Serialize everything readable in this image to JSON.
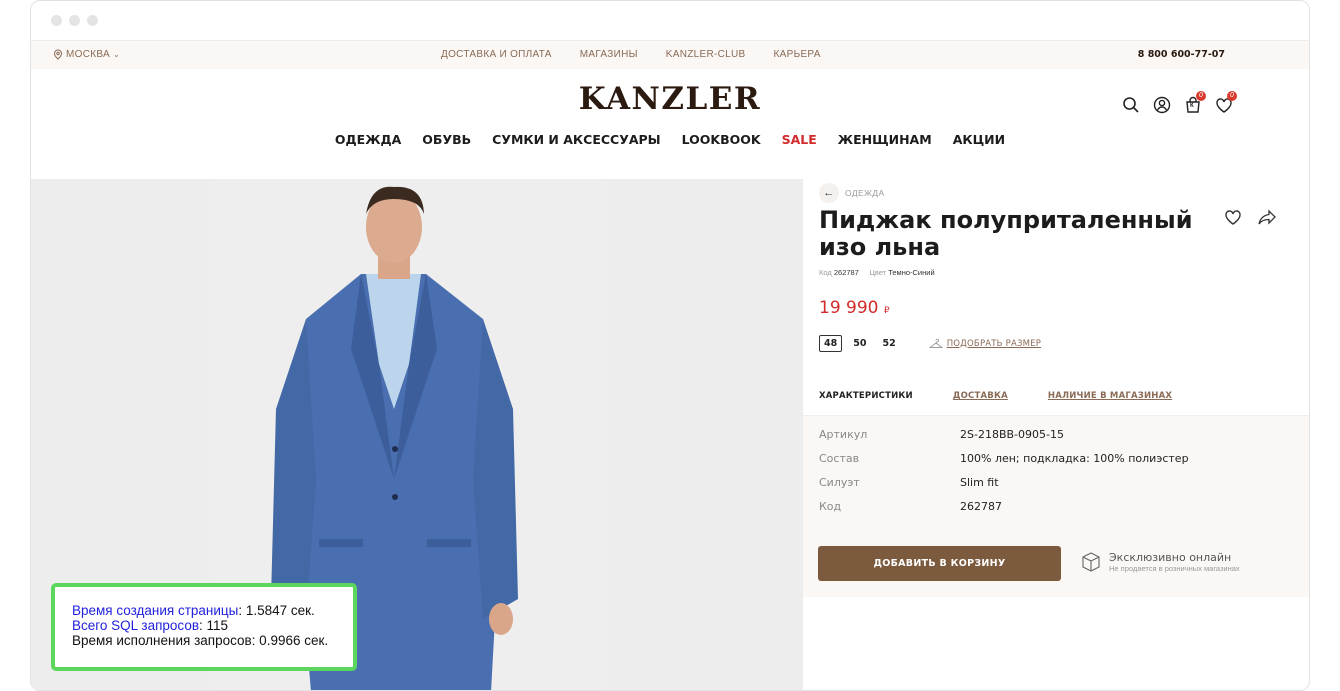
{
  "topbar": {
    "city": "МОСКВА",
    "nav": [
      "ДОСТАВКА И ОПЛАТА",
      "МАГАЗИНЫ",
      "KANZLER-CLUB",
      "КАРЬЕРА"
    ],
    "phone": "8 800 600-77-07"
  },
  "header": {
    "logo": "KANZLER",
    "cart_count": "0",
    "fav_count": "0",
    "cart_letter": "К"
  },
  "mainnav": [
    "ОДЕЖДА",
    "ОБУВЬ",
    "СУМКИ И АКСЕССУАРЫ",
    "LOOKBOOK",
    "SALE",
    "ЖЕНЩИНАМ",
    "АКЦИИ"
  ],
  "colors": {
    "brand": "#2b1a10",
    "accent": "#7c5a3e",
    "sale": "#d32b2b",
    "debug_border": "#5cd65c"
  },
  "debug": {
    "time_label": "Время создания страницы",
    "time_value": ": 1.5847 сек.",
    "sql_label": "Всего SQL запросов",
    "sql_value": ": 115",
    "exec_text": "Время исполнения запросов: 0.9966 сек."
  },
  "product": {
    "breadcrumb": "ОДЕЖДА",
    "title": "Пиджак полуприталенный изо льна",
    "code_label": "Код",
    "code": "262787",
    "color_label": "Цвет",
    "color": "Темно-Синий",
    "price": "19 990",
    "currency": "₽",
    "sizes": [
      "48",
      "50",
      "52"
    ],
    "selected_size": "48",
    "fit_link": "ПОДОБРАТЬ РАЗМЕР",
    "tabs": [
      "ХАРАКТЕРИСТИКИ",
      "ДОСТАВКА",
      "НАЛИЧИЕ В МАГАЗИНАХ"
    ],
    "specs": [
      {
        "k": "Артикул",
        "v": "2S-218BB-0905-15"
      },
      {
        "k": "Состав",
        "v": "100% лен; подкладка: 100% полиэстер"
      },
      {
        "k": "Силуэт",
        "v": "Slim fit"
      },
      {
        "k": "Код",
        "v": "262787"
      }
    ],
    "add_to_cart": "ДОБАВИТЬ В КОРЗИНУ",
    "exclusive_title": "Эксклюзивно онлайн",
    "exclusive_sub": "Не продается в розничных магазинах"
  }
}
